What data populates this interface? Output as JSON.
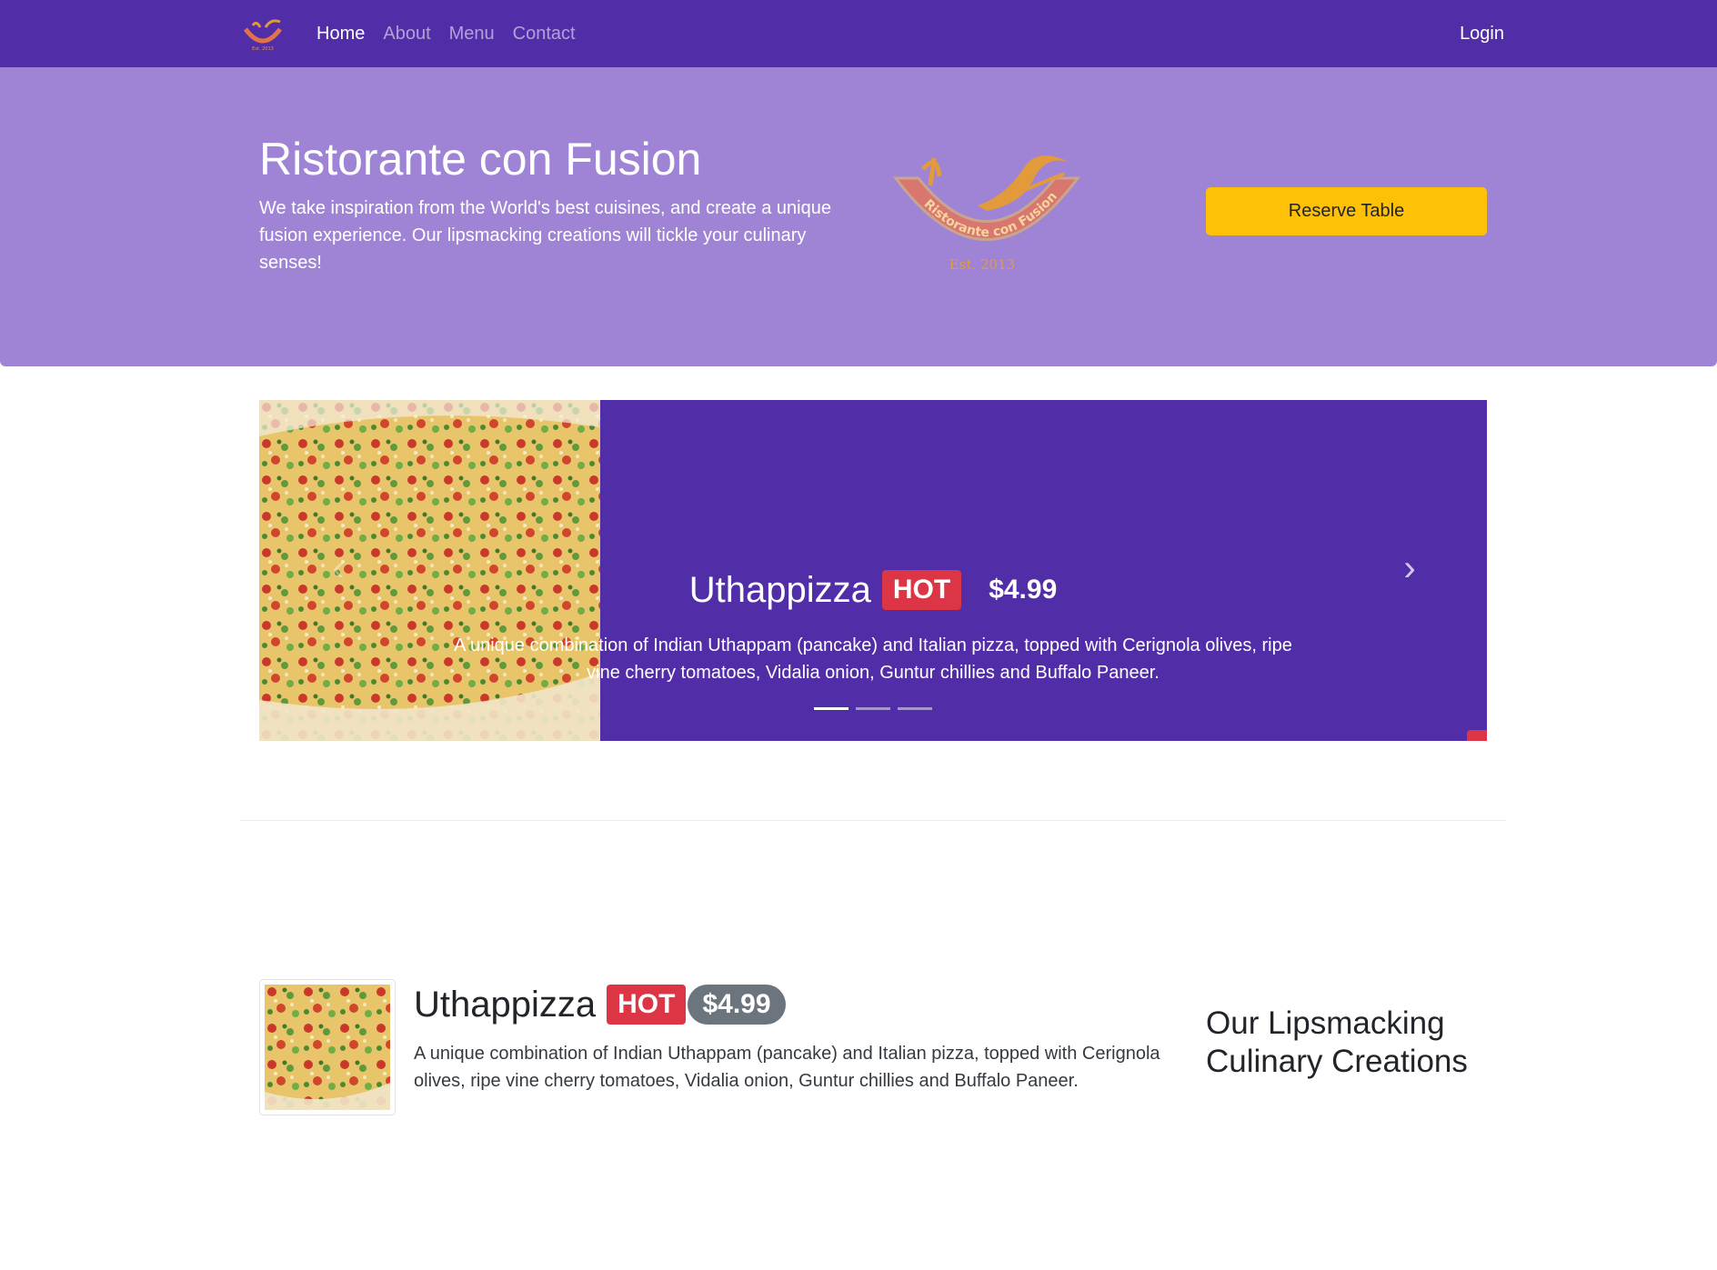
{
  "navbar": {
    "logo_alt": "Ristorante con Fusion logo",
    "links": [
      {
        "label": "Home",
        "active": true
      },
      {
        "label": "About",
        "active": false
      },
      {
        "label": "Menu",
        "active": false
      },
      {
        "label": "Contact",
        "active": false
      }
    ],
    "login_label": "Login",
    "background": "#512DA8"
  },
  "jumbotron": {
    "title": "Ristorante con Fusion",
    "text": "We take inspiration from the World's best cuisines, and create a unique fusion experience. Our lipsmacking creations will tickle your culinary senses!",
    "logo": {
      "name": "Ristorante con Fusion",
      "established": "Est. 2013"
    },
    "reserve_label": "Reserve Table",
    "background": "#9F84D6",
    "button_color": "#FFC107"
  },
  "carousel": {
    "slide": {
      "name": "Uthappizza",
      "badge": "HOT",
      "price": "$4.99",
      "description": "A unique combination of Indian Uthappam (pancake) and Italian pizza, topped with Cerignola olives, ripe vine cherry tomatoes, Vidalia onion, Guntur chillies and Buffalo Paneer."
    },
    "prev_icon": "chevron-left-icon",
    "next_icon": "chevron-right-icon",
    "indicator_count": 3,
    "active_indicator": 0
  },
  "featured": {
    "name": "Uthappizza",
    "badge": "HOT",
    "price": "$4.99",
    "description": "A unique combination of Indian Uthappam (pancake) and Italian pizza, topped with Cerignola olives, ripe vine cherry tomatoes, Vidalia onion, Guntur chillies and Buffalo Paneer."
  },
  "side_heading": "Our Lipsmacking Culinary Creations",
  "colors": {
    "hot_badge": "#DC3545",
    "price_badge": "#6C757D"
  }
}
